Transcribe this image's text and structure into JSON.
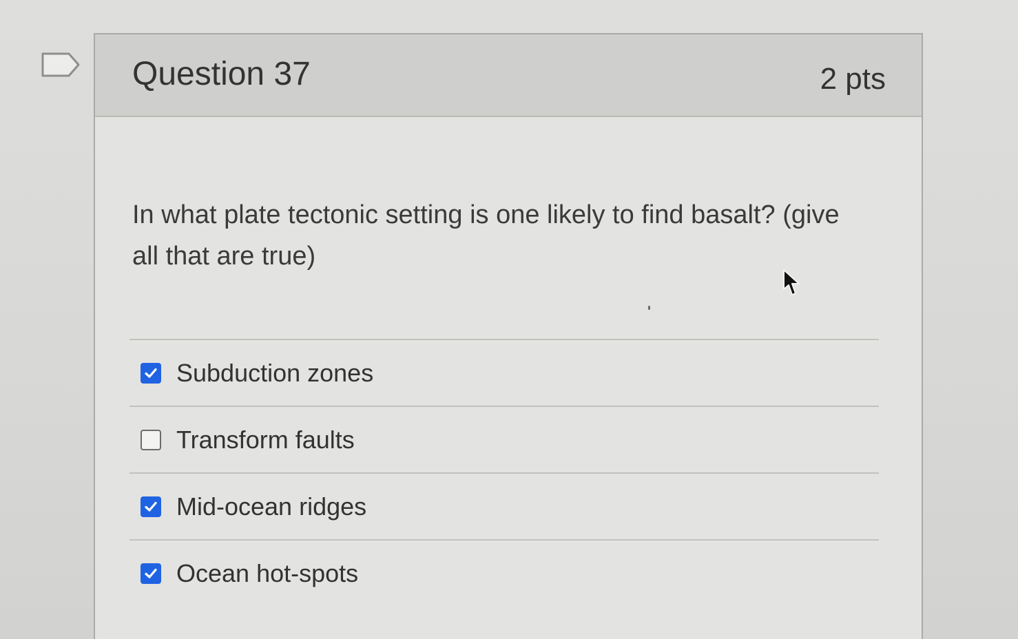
{
  "question": {
    "title": "Question 37",
    "points": "2 pts",
    "text": "In what plate tectonic setting is one likely to find basalt? (give all that are true)",
    "flag_icon": "flag-icon"
  },
  "answers": [
    {
      "label": "Subduction zones",
      "checked": true
    },
    {
      "label": "Transform faults",
      "checked": false
    },
    {
      "label": "Mid-ocean ridges",
      "checked": true
    },
    {
      "label": "Ocean hot-spots",
      "checked": true
    }
  ],
  "colors": {
    "checkbox_checked": "#1f63e3",
    "header_bg": "#cfcfcd",
    "card_bg": "#e3e3e1"
  }
}
